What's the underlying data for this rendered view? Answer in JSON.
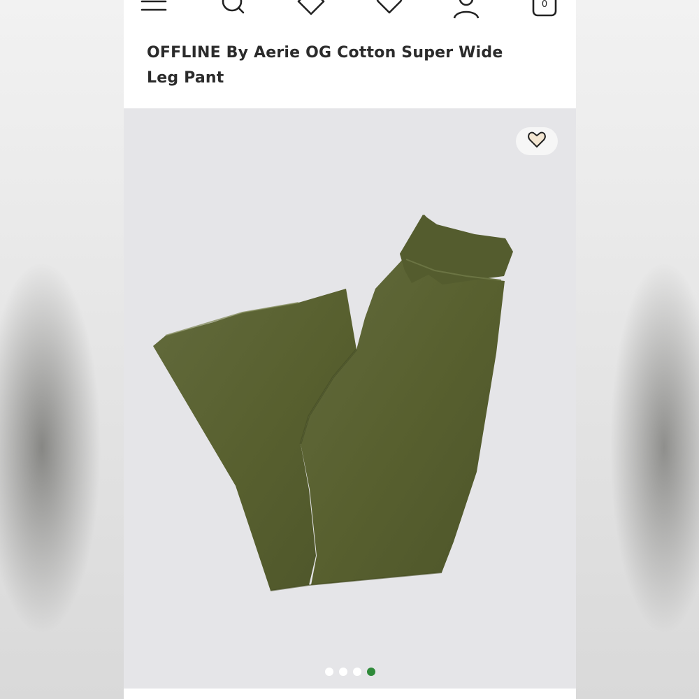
{
  "header": {
    "icons": [
      "menu-icon",
      "search-icon",
      "tag-icon",
      "heart-icon",
      "account-icon",
      "bag-icon"
    ],
    "bag_count": "0"
  },
  "product": {
    "title": "OFFLINE By Aerie OG Cotton Super Wide Leg Pant"
  },
  "gallery": {
    "image": "olive-green-wide-leg-pant",
    "total_images": 4,
    "active_index": 4
  },
  "colors": {
    "accent": "#2f8a3a",
    "pant": "#5a6135",
    "gallery_bg": "#e5e5e8",
    "favorite_heart_fill": "#f3e6d2"
  }
}
